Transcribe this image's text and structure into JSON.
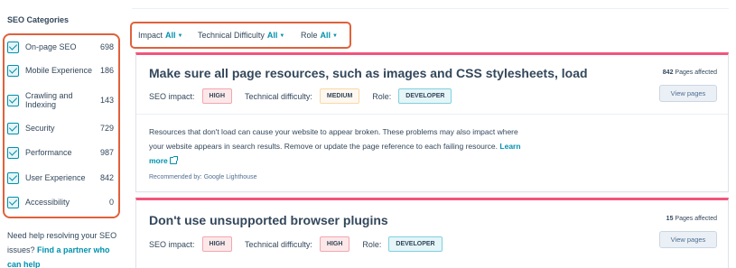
{
  "sidebar": {
    "title": "SEO Categories",
    "categories": [
      {
        "label": "On-page SEO",
        "count": "698",
        "checked": true
      },
      {
        "label": "Mobile Experience",
        "count": "186",
        "checked": true
      },
      {
        "label": "Crawling and Indexing",
        "count": "143",
        "checked": true
      },
      {
        "label": "Security",
        "count": "729",
        "checked": true
      },
      {
        "label": "Performance",
        "count": "987",
        "checked": true
      },
      {
        "label": "User Experience",
        "count": "842",
        "checked": true
      },
      {
        "label": "Accessibility",
        "count": "0",
        "checked": true
      }
    ],
    "help_text": "Need help resolving your SEO issues?",
    "help_link": "Find a partner who can help"
  },
  "filters": {
    "impact": {
      "label": "Impact",
      "value": "All"
    },
    "difficulty": {
      "label": "Technical Difficulty",
      "value": "All"
    },
    "role": {
      "label": "Role",
      "value": "All"
    }
  },
  "cards": [
    {
      "title": "Make sure all page resources, such as images and CSS stylesheets, load",
      "pages_count": "842",
      "pages_label": "Pages affected",
      "view_label": "View pages",
      "impact_label": "SEO impact:",
      "impact": "HIGH",
      "difficulty_label": "Technical difficulty:",
      "difficulty": "MEDIUM",
      "role_label": "Role:",
      "role": "DEVELOPER",
      "description": "Resources that don't load can cause your website to appear broken. These problems may also impact where your website appears in search results. Remove or update the page reference to each failing resource.",
      "learn_more": "Learn more",
      "recommended": "Recommended by: Google Lighthouse"
    },
    {
      "title": "Don't use unsupported browser plugins",
      "pages_count": "15",
      "pages_label": "Pages affected",
      "view_label": "View pages",
      "impact_label": "SEO impact:",
      "impact": "HIGH",
      "difficulty_label": "Technical difficulty:",
      "difficulty": "HIGH",
      "role_label": "Role:",
      "role": "DEVELOPER"
    }
  ],
  "colors": {
    "accent": "#0091ae",
    "highlight_border": "#e0613b",
    "card_top_border": "#f2547d",
    "text": "#33475b"
  },
  "icons": [
    "checkbox-checked-icon",
    "chevron-down-icon",
    "external-link-icon"
  ]
}
